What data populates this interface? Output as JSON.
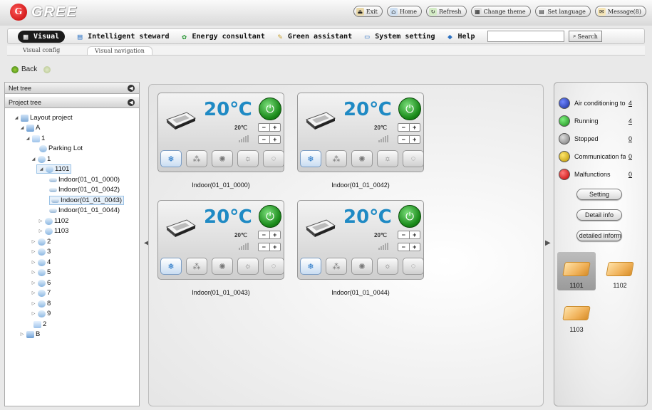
{
  "brand": {
    "logo_text": "GREE",
    "logo_mark": "G"
  },
  "top_buttons": [
    {
      "label": "Exit",
      "icon": "exit-icon"
    },
    {
      "label": "Home",
      "icon": "home-icon"
    },
    {
      "label": "Refresh",
      "icon": "refresh-icon"
    },
    {
      "label": "Change theme",
      "icon": "theme-icon"
    },
    {
      "label": "Set language",
      "icon": "language-icon"
    },
    {
      "label": "Message(8)",
      "icon": "message-icon"
    }
  ],
  "menu": [
    {
      "label": "Visual",
      "icon": "visual-icon",
      "active": true
    },
    {
      "label": "Intelligent steward",
      "icon": "steward-icon"
    },
    {
      "label": "Energy consultant",
      "icon": "energy-icon"
    },
    {
      "label": "Green assistant",
      "icon": "assistant-icon"
    },
    {
      "label": "System setting",
      "icon": "monitor-icon"
    },
    {
      "label": "Help",
      "icon": "help-icon"
    }
  ],
  "search": {
    "value": "",
    "button_label": "Search"
  },
  "subtabs": [
    {
      "label": "Visual config"
    },
    {
      "label": "Visual navigation",
      "active": true
    }
  ],
  "back_label": "Back",
  "left_panel": {
    "net_tree_label": "Net tree",
    "project_tree_label": "Project tree",
    "tree": [
      {
        "label": "Layout project"
      },
      {
        "label": "A"
      },
      {
        "label": "1"
      },
      {
        "label": "Parking Lot"
      },
      {
        "label": "1"
      },
      {
        "label": "1101"
      },
      {
        "label": "Indoor(01_01_0000)"
      },
      {
        "label": "Indoor(01_01_0042)"
      },
      {
        "label": "Indoor(01_01_0043)"
      },
      {
        "label": "Indoor(01_01_0044)"
      },
      {
        "label": "1102"
      },
      {
        "label": "1103"
      },
      {
        "label": "2"
      },
      {
        "label": "3"
      },
      {
        "label": "4"
      },
      {
        "label": "5"
      },
      {
        "label": "6"
      },
      {
        "label": "7"
      },
      {
        "label": "8"
      },
      {
        "label": "9"
      },
      {
        "label": "2"
      },
      {
        "label": "B"
      }
    ]
  },
  "units": [
    {
      "name": "Indoor(01_01_0000)",
      "set_temp": "20℃",
      "current_temp": "20℃",
      "plus": "+",
      "minus": "−"
    },
    {
      "name": "Indoor(01_01_0042)",
      "set_temp": "20℃",
      "current_temp": "20℃",
      "plus": "+",
      "minus": "−"
    },
    {
      "name": "Indoor(01_01_0043)",
      "set_temp": "20℃",
      "current_temp": "20℃",
      "plus": "+",
      "minus": "−"
    },
    {
      "name": "Indoor(01_01_0044)",
      "set_temp": "20℃",
      "current_temp": "20℃",
      "plus": "+",
      "minus": "−"
    }
  ],
  "mode_icons": [
    "cool-icon",
    "dry-icon",
    "fan-icon",
    "heat-icon",
    "auto-icon"
  ],
  "status": [
    {
      "label": "Air conditioning to",
      "count": "4",
      "color": "#1a2f9a"
    },
    {
      "label": "Running",
      "count": "4",
      "color": "#1a8a1a"
    },
    {
      "label": "Stopped",
      "count": "0",
      "color": "#8a8a8a"
    },
    {
      "label": "Communication fa",
      "count": "0",
      "color": "#c9a400"
    },
    {
      "label": "Malfunctions",
      "count": "0",
      "color": "#d01010"
    }
  ],
  "right_buttons": {
    "setting": "Setting",
    "detail_info": "Detail info",
    "detailed_info": "e detailed informa"
  },
  "rooms": [
    {
      "label": "1101"
    },
    {
      "label": "1102"
    },
    {
      "label": "1103"
    }
  ]
}
